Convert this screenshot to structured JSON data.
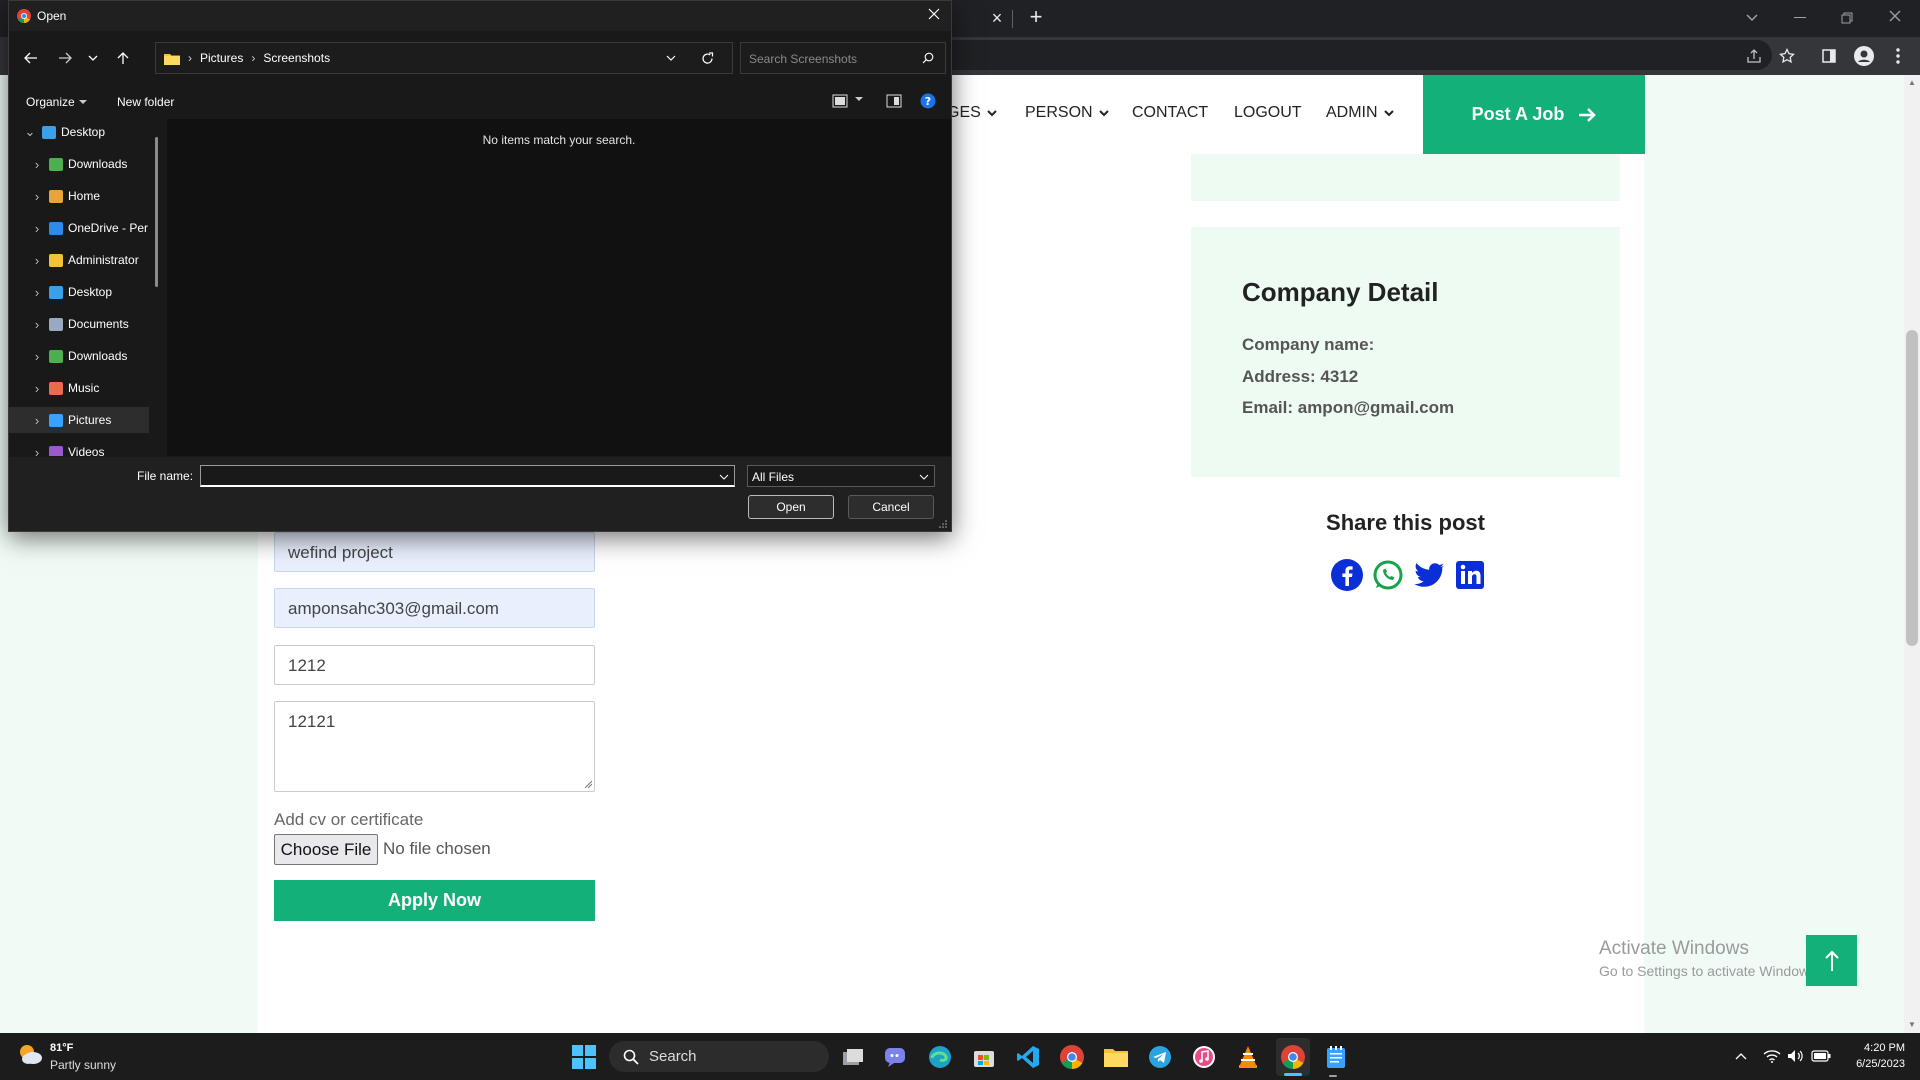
{
  "browser": {
    "new_tab_glyph": "+",
    "close_tab_glyph": "×"
  },
  "nav": {
    "items": [
      {
        "label": "GES",
        "dropdown": true
      },
      {
        "label": "PERSON",
        "dropdown": true
      },
      {
        "label": "CONTACT",
        "dropdown": false
      },
      {
        "label": "LOGOUT",
        "dropdown": false
      },
      {
        "label": "ADMIN",
        "dropdown": true
      }
    ],
    "post_job_label": "Post A Job"
  },
  "company": {
    "title": "Company Detail",
    "name_line": "Company name:",
    "address_line": "Address: 4312",
    "email_line": "Email: ampon@gmail.com"
  },
  "share": {
    "title": "Share this post",
    "icons": [
      "facebook-icon",
      "whatsapp-icon",
      "twitter-icon",
      "linkedin-icon"
    ]
  },
  "form": {
    "name_value": "wefind project",
    "email_value": "amponsahc303@gmail.com",
    "phone_value": "1212",
    "message_value": "12121",
    "cv_label": "Add cv or certificate",
    "choose_file_label": "Choose File",
    "no_file_label": "No file chosen",
    "apply_label": "Apply Now"
  },
  "watermark": {
    "line1": "Activate Windows",
    "line2": "Go to Settings to activate Windows."
  },
  "dialog": {
    "title": "Open",
    "breadcrumb": [
      "Pictures",
      "Screenshots"
    ],
    "search_placeholder": "Search Screenshots",
    "organize_label": "Organize",
    "new_folder_label": "New folder",
    "empty_message": "No items match your search.",
    "tree": [
      {
        "label": "Desktop",
        "icon": "desktop",
        "expanded": true,
        "indent": 0
      },
      {
        "label": "Downloads",
        "icon": "download",
        "indent": 1
      },
      {
        "label": "Home",
        "icon": "home",
        "indent": 1
      },
      {
        "label": "OneDrive - Per",
        "icon": "cloud",
        "indent": 1
      },
      {
        "label": "Administrator",
        "icon": "folder",
        "indent": 1
      },
      {
        "label": "Desktop",
        "icon": "desktop",
        "indent": 1
      },
      {
        "label": "Documents",
        "icon": "documents",
        "indent": 1
      },
      {
        "label": "Downloads",
        "icon": "download",
        "indent": 1
      },
      {
        "label": "Music",
        "icon": "music",
        "indent": 1
      },
      {
        "label": "Pictures",
        "icon": "pictures",
        "indent": 1,
        "selected": true
      },
      {
        "label": "Videos",
        "icon": "videos",
        "indent": 1
      }
    ],
    "file_name_label": "File name:",
    "file_name_value": "",
    "file_type_value": "All Files",
    "open_label": "Open",
    "cancel_label": "Cancel"
  },
  "taskbar": {
    "weather_temp": "81°F",
    "weather_desc": "Partly sunny",
    "search_label": "Search",
    "time": "4:20 PM",
    "date": "6/25/2023"
  },
  "colors": {
    "accent": "#14b07a",
    "card_bg": "#eefbf3",
    "page_bg": "#f1fbf6",
    "dialog_bg": "#191919"
  }
}
